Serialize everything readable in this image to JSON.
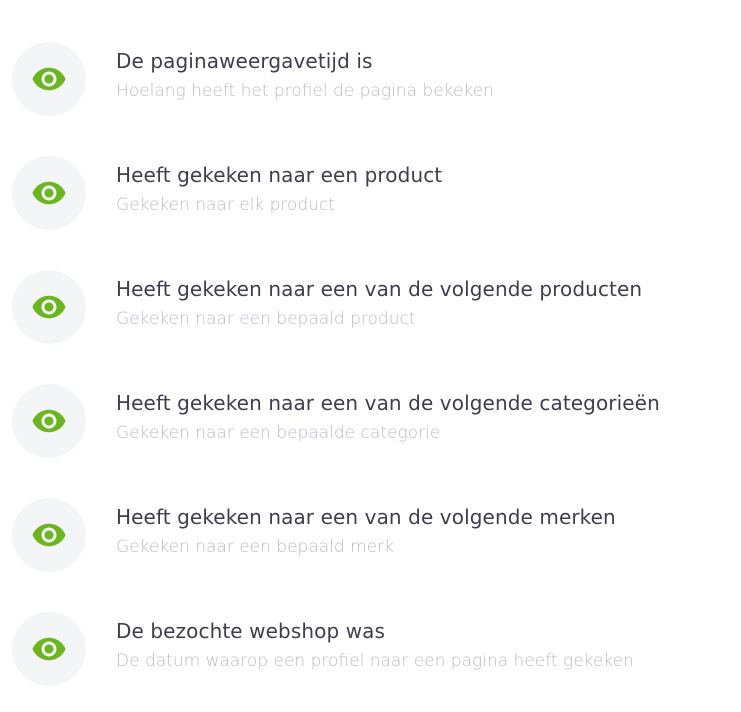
{
  "items": [
    {
      "title": "De paginaweergavetijd is",
      "subtitle": "Hoelang heeft het profiel de pagina bekeken",
      "icon": "eye-icon"
    },
    {
      "title": "Heeft gekeken naar een product",
      "subtitle": "Gekeken naar elk product",
      "icon": "eye-icon"
    },
    {
      "title": "Heeft gekeken naar een van de volgende producten",
      "subtitle": "Gekeken naar een bepaald product",
      "icon": "eye-icon"
    },
    {
      "title": "Heeft gekeken naar een van de volgende categorieën",
      "subtitle": "Gekeken naar een bepaalde categorie",
      "icon": "eye-icon"
    },
    {
      "title": "Heeft gekeken naar een van de volgende merken",
      "subtitle": "Gekeken naar een bepaald merk",
      "icon": "eye-icon"
    },
    {
      "title": "De bezochte webshop was",
      "subtitle": "De datum waarop een profiel naar een pagina heeft gekeken",
      "icon": "eye-icon"
    }
  ],
  "colors": {
    "icon": "#6cb51e",
    "icon_bg": "#f4f5f7",
    "title": "#3f3e4f",
    "subtitle": "#b9bbcb"
  }
}
